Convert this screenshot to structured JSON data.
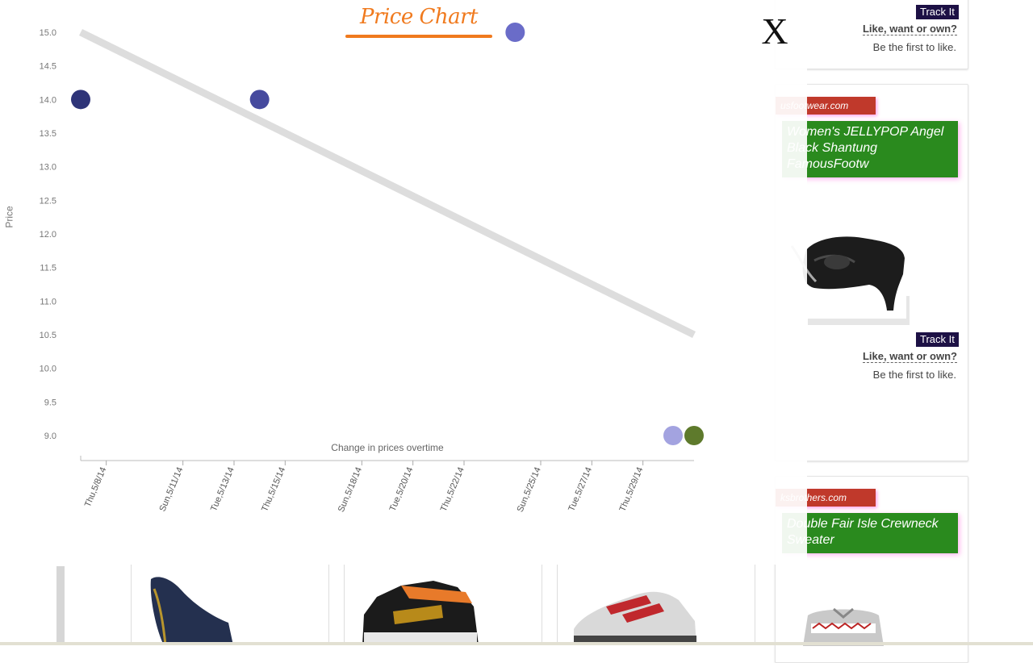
{
  "sidebar_cards": [
    {
      "track_label": "Track It",
      "like_label": "Like, want or own?",
      "first_like": "Be the first to like."
    },
    {
      "store": "usfootwear.com",
      "title": "Women's JELLYPOP Angel Black Shantung FamousFootw",
      "track_label": "Track It",
      "like_label": "Like, want or own?",
      "first_like": "Be the first to like.",
      "image_icon": "black-heel-shoe-image"
    },
    {
      "store": "ksbrothers.com",
      "title": "Double Fair Isle Crewneck Sweater",
      "image_icon": "sweater-image"
    }
  ],
  "bottom_products": [
    {
      "image_icon": "navy-pump-image"
    },
    {
      "image_icon": "hightop-sneaker-image"
    },
    {
      "image_icon": "running-shoe-image"
    }
  ],
  "overlay": {
    "title": "Price Chart",
    "close_label": "X",
    "accent": "#f07a1e"
  },
  "chart_data": {
    "type": "scatter",
    "title": "Price Chart",
    "xlabel": "Change in prices overtime",
    "ylabel": "Price",
    "ylim": [
      9.0,
      15.0
    ],
    "yticks": [
      "15.0",
      "14.5",
      "14.0",
      "13.5",
      "13.0",
      "12.5",
      "12.0",
      "11.5",
      "11.0",
      "10.5",
      "10.0",
      "9.5",
      "9.0"
    ],
    "xticks": [
      "Thu,5/8/14",
      "Sun,5/11/14",
      "Tue,5/13/14",
      "Thu,5/15/14",
      "Sun,5/18/14",
      "Tue,5/20/14",
      "Thu,5/22/14",
      "Sun,5/25/14",
      "Tue,5/27/14",
      "Thu,5/29/14"
    ],
    "xlim": [
      "2014-05-07",
      "2014-05-31"
    ],
    "points": [
      {
        "x": "2014-05-07",
        "y": 14.0,
        "color": "#2e3478"
      },
      {
        "x": "2014-05-14",
        "y": 14.0,
        "color": "#464a9e"
      },
      {
        "x": "2014-05-24",
        "y": 15.0,
        "color": "#6a6cc8"
      },
      {
        "x": "2014-05-31",
        "y": 9.0,
        "color": "#a3a3e0"
      },
      {
        "x": "2014-05-31",
        "y": 9.0,
        "color": "#5e7a2c"
      }
    ],
    "trend": {
      "start": {
        "x": "2014-05-07",
        "y": 15.0
      },
      "end": {
        "x": "2014-05-31",
        "y": 10.5
      },
      "color": "#dddddd"
    },
    "grid": false
  }
}
